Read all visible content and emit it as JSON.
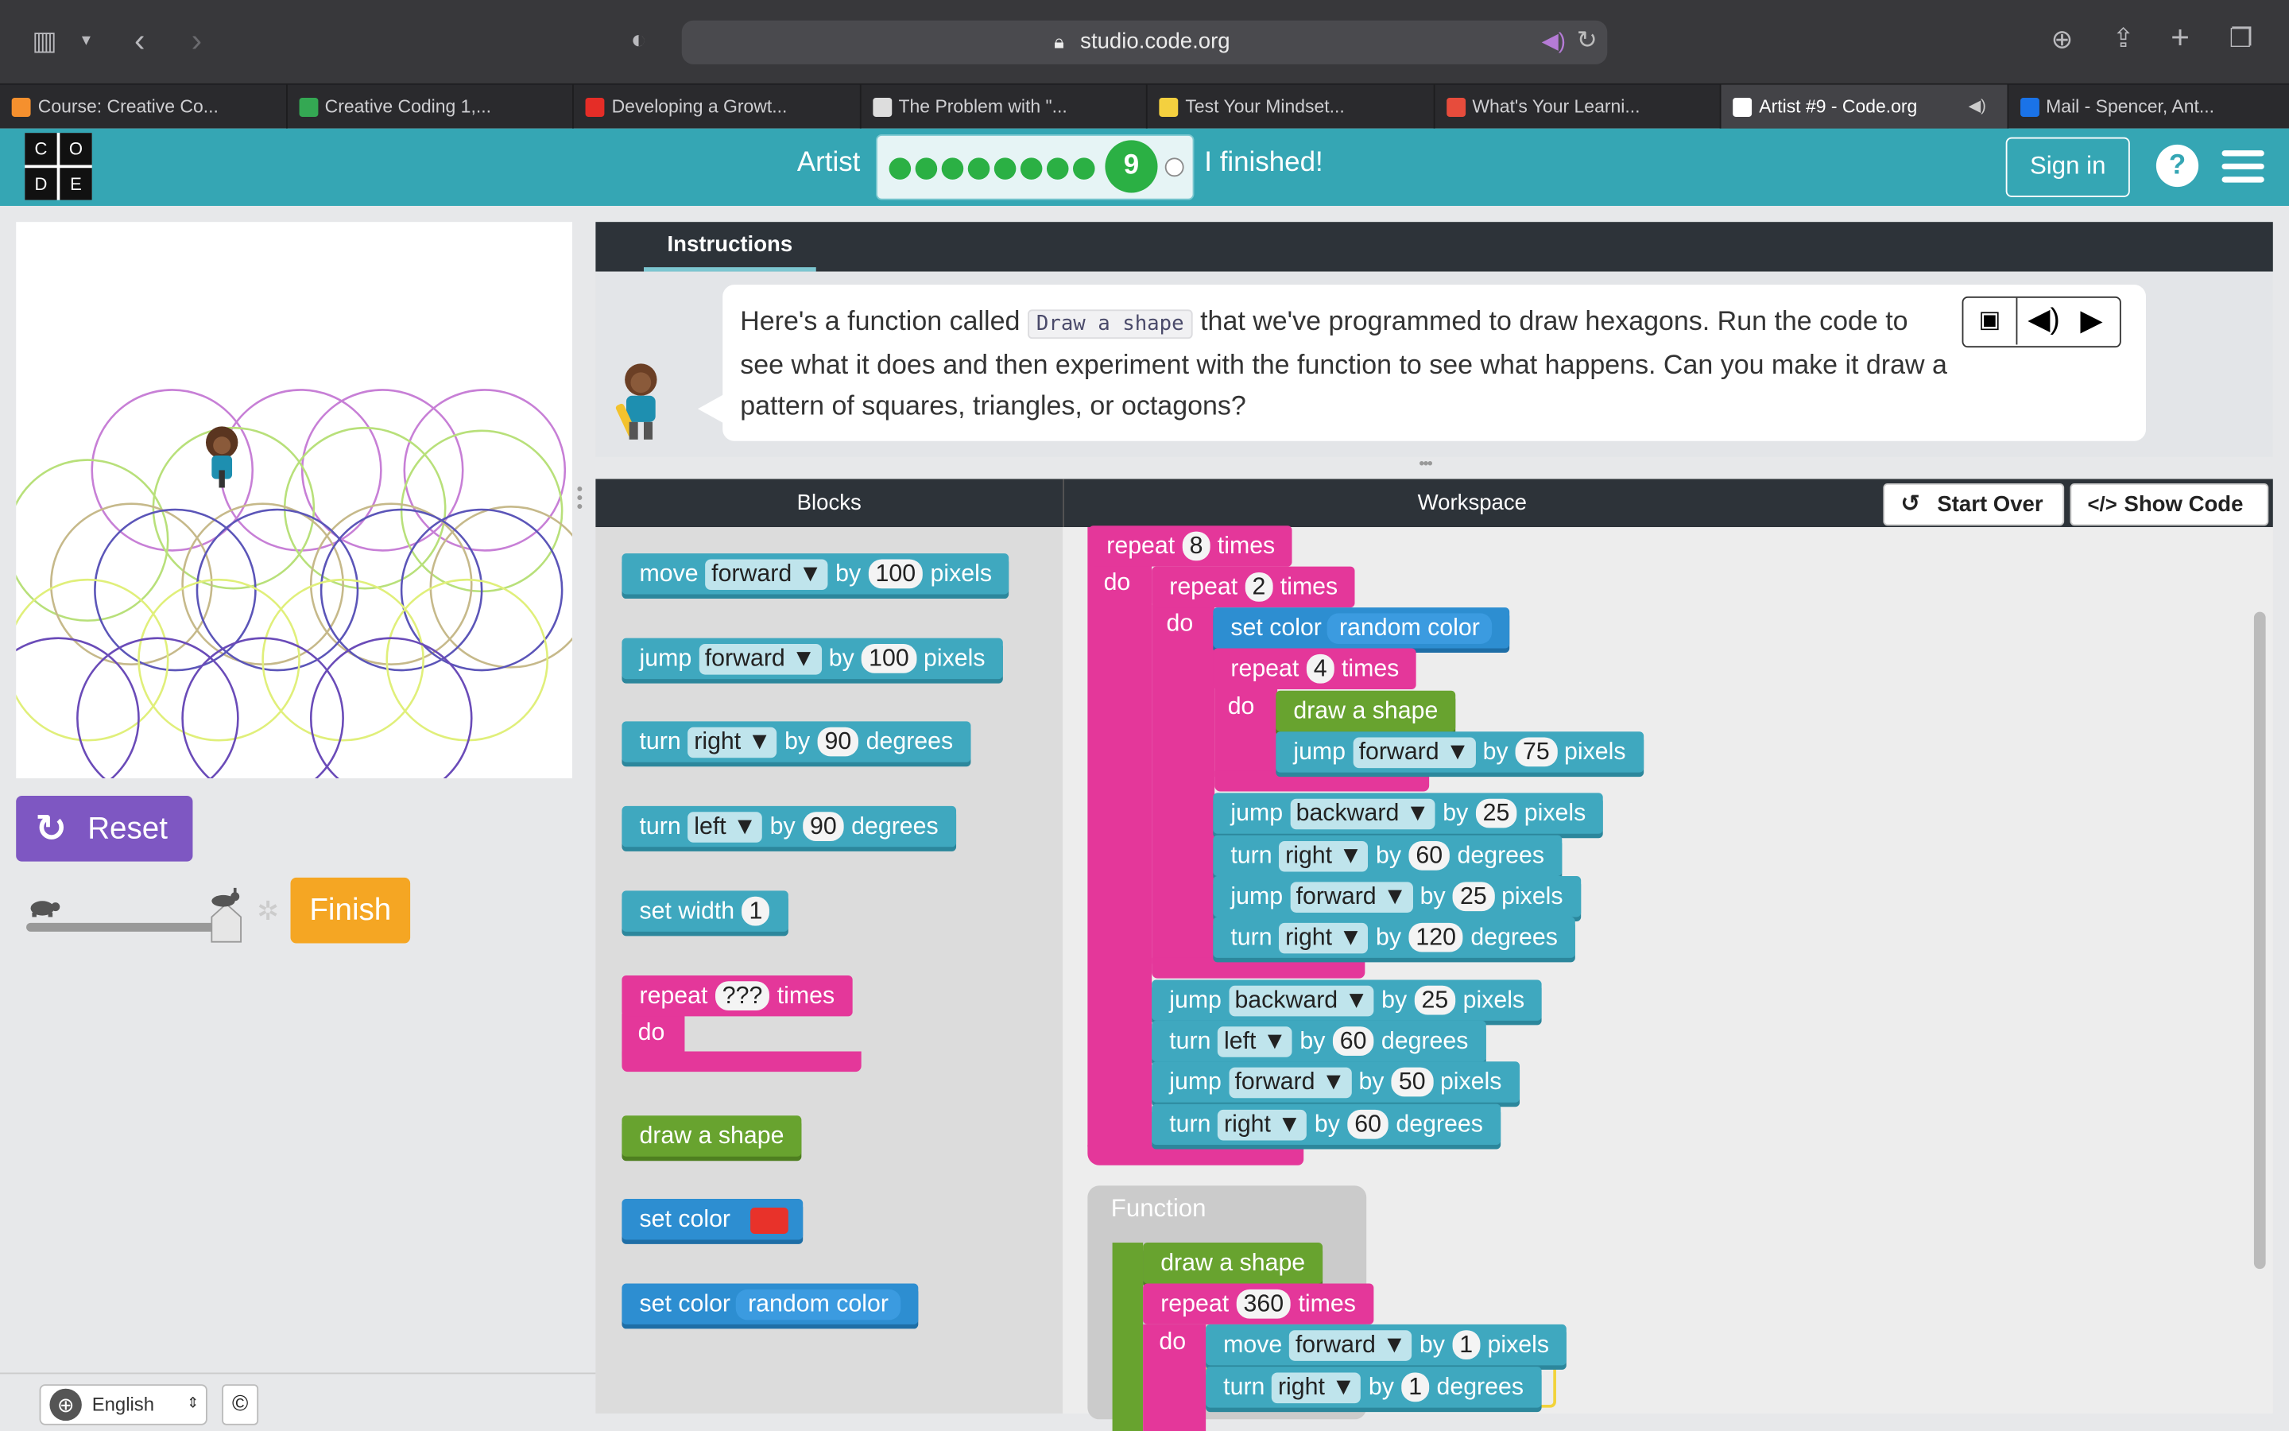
{
  "browser": {
    "url": "studio.code.org",
    "tabs": [
      {
        "label": "Course: Creative Co...",
        "icon": "moodle-icon",
        "color": "#f5902e"
      },
      {
        "label": "Creative Coding 1,...",
        "icon": "drive-icon",
        "color": "#34a853"
      },
      {
        "label": "Developing a Growt...",
        "icon": "youtube-icon",
        "color": "#e52d27"
      },
      {
        "label": "The Problem with \"...",
        "icon": "sa-icon",
        "color": "#dddddd"
      },
      {
        "label": "Test Your Mindset...",
        "icon": "bulb-icon",
        "color": "#f4d03f"
      },
      {
        "label": "What's Your Learni...",
        "icon": "apple-icon",
        "color": "#e74c3c"
      },
      {
        "label": "Artist #9 - Code.org",
        "icon": "codeorg-icon",
        "color": "#ffffff",
        "active": true
      },
      {
        "label": "Mail - Spencer, Ant...",
        "icon": "outlook-icon",
        "color": "#1a73e8"
      }
    ]
  },
  "header": {
    "logo_letters": [
      "C",
      "O",
      "D",
      "E"
    ],
    "lesson": "Artist",
    "current_level": "9",
    "finished": "I finished!",
    "sign_in": "Sign in",
    "help": "?"
  },
  "controls": {
    "reset": "Reset",
    "finish": "Finish",
    "language": "English",
    "copyright": "©"
  },
  "instructions": {
    "tab": "Instructions",
    "text_before": "Here's a function called ",
    "code": "Draw a shape",
    "text_after": " that we've programmed to draw hexagons. Run the code to see what it does and then experiment with the function to see what happens. Can you make it draw a pattern of squares, triangles, or octagons?"
  },
  "workspace": {
    "blocks_label": "Blocks",
    "workspace_label": "Workspace",
    "start_over": "Start Over",
    "show_code": "Show Code",
    "function_label": "Function"
  },
  "toolbox": [
    {
      "kind": "teal",
      "parts": [
        "move",
        "forward ▼",
        "by",
        "100",
        "pixels"
      ]
    },
    {
      "kind": "teal",
      "parts": [
        "jump",
        "forward ▼",
        "by",
        "100",
        "pixels"
      ]
    },
    {
      "kind": "teal",
      "parts": [
        "turn",
        "right ▼",
        "by",
        "90",
        "degrees"
      ]
    },
    {
      "kind": "teal",
      "parts": [
        "turn",
        "left ▼",
        "by",
        "90",
        "degrees"
      ]
    },
    {
      "kind": "teal",
      "parts": [
        "set width",
        "1"
      ]
    },
    {
      "kind": "pink",
      "parts": [
        "repeat",
        "???",
        "times"
      ],
      "do": "do"
    },
    {
      "kind": "green",
      "parts": [
        "draw a shape"
      ]
    },
    {
      "kind": "blue",
      "parts": [
        "set color"
      ],
      "swatch": "#e8322a"
    },
    {
      "kind": "blue",
      "parts": [
        "set color",
        "random color"
      ]
    }
  ],
  "program": [
    {
      "kind": "pink",
      "parts": [
        "repeat",
        "8",
        "times"
      ]
    },
    {
      "kind": "pink",
      "parts": [
        "repeat",
        "2",
        "times"
      ]
    },
    {
      "kind": "blue",
      "parts": [
        "set color",
        "random color"
      ]
    },
    {
      "kind": "pink",
      "parts": [
        "repeat",
        "4",
        "times"
      ]
    },
    {
      "kind": "green",
      "parts": [
        "draw a shape"
      ]
    },
    {
      "kind": "teal",
      "parts": [
        "jump",
        "forward ▼",
        "by",
        "75",
        "pixels"
      ]
    },
    {
      "kind": "teal",
      "parts": [
        "jump",
        "backward ▼",
        "by",
        "25",
        "pixels"
      ]
    },
    {
      "kind": "teal",
      "parts": [
        "turn",
        "right ▼",
        "by",
        "60",
        "degrees"
      ]
    },
    {
      "kind": "teal",
      "parts": [
        "jump",
        "forward ▼",
        "by",
        "25",
        "pixels"
      ]
    },
    {
      "kind": "teal",
      "parts": [
        "turn",
        "right ▼",
        "by",
        "120",
        "degrees"
      ]
    },
    {
      "kind": "teal",
      "parts": [
        "jump",
        "backward ▼",
        "by",
        "25",
        "pixels"
      ]
    },
    {
      "kind": "teal",
      "parts": [
        "turn",
        "left ▼",
        "by",
        "60",
        "degrees"
      ]
    },
    {
      "kind": "teal",
      "parts": [
        "jump",
        "forward ▼",
        "by",
        "50",
        "pixels"
      ]
    },
    {
      "kind": "teal",
      "parts": [
        "turn",
        "right ▼",
        "by",
        "60",
        "degrees"
      ]
    }
  ],
  "function_def": [
    {
      "kind": "green",
      "parts": [
        "draw a shape"
      ]
    },
    {
      "kind": "pink",
      "parts": [
        "repeat",
        "360",
        "times"
      ]
    },
    {
      "kind": "teal",
      "parts": [
        "move",
        "forward ▼",
        "by",
        "1",
        "pixels"
      ]
    },
    {
      "kind": "teal",
      "parts": [
        "turn",
        "right ▼",
        "by",
        "1",
        "degrees"
      ]
    }
  ],
  "do_label": "do",
  "colors": {
    "header": "#35a6b4",
    "reset": "#7e57c2",
    "finish": "#f5a623",
    "progress": "#2bb044"
  }
}
